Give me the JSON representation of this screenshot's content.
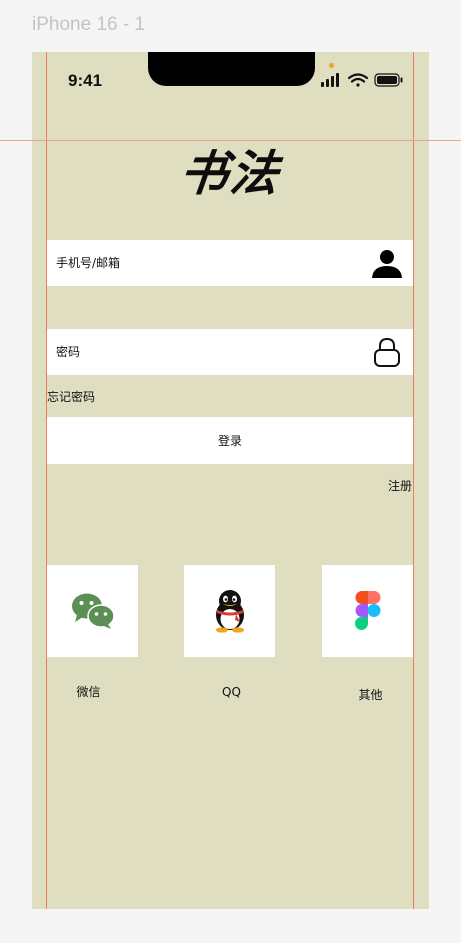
{
  "frame": {
    "label": "iPhone 16 - 1"
  },
  "status_bar": {
    "time": "9:41"
  },
  "app": {
    "title": "书法"
  },
  "login_form": {
    "account_placeholder": "手机号/邮箱",
    "password_placeholder": "密码",
    "forgot_password": "忘记密码",
    "login_button": "登录",
    "register_link": "注册"
  },
  "social_login": [
    {
      "label": "微信",
      "icon": "wechat-icon"
    },
    {
      "label": "QQ",
      "icon": "qq-icon"
    },
    {
      "label": "其他",
      "icon": "figma-icon"
    }
  ],
  "colors": {
    "background": "#e0dec1",
    "guide": "#f07a5f",
    "wechat": "#5b8f54"
  }
}
